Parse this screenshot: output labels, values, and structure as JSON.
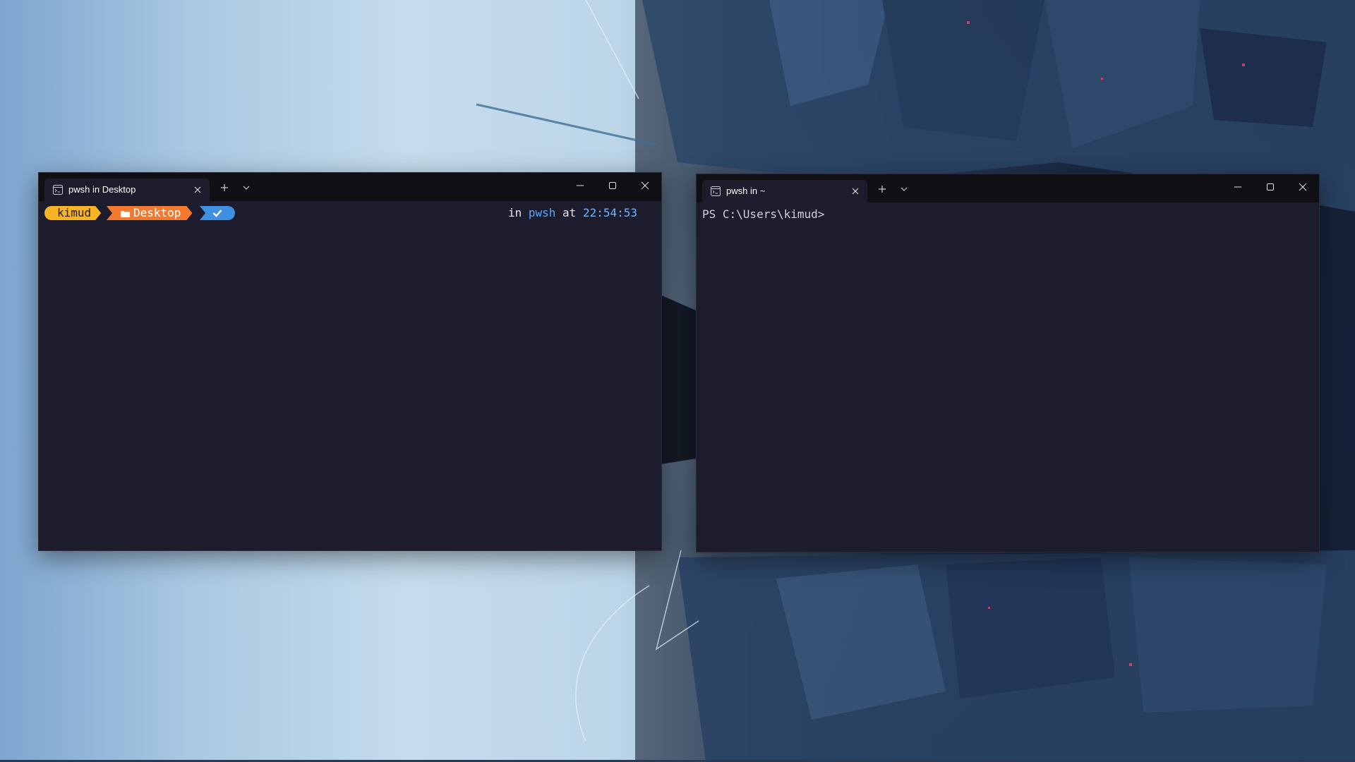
{
  "colors": {
    "terminal_bg": "#1c1c2c",
    "titlebar_bg": "#0f0f14",
    "user_segment": "#f8b324",
    "path_segment": "#f3792e",
    "status_segment": "#3f8fe3",
    "accent_blue": "#5ea8ff"
  },
  "left_window": {
    "tab_title": "pwsh in Desktop",
    "tab_icon": "terminal-icon",
    "prompt": {
      "user": "kimud",
      "path_icon": "folder-icon",
      "path": "Desktop",
      "status_icon": "check-icon",
      "right_in": "in",
      "right_shell": "pwsh",
      "right_at": "at",
      "right_time": "22:54:53"
    }
  },
  "right_window": {
    "tab_title": "pwsh in ~",
    "tab_icon": "terminal-icon",
    "prompt_line": "PS C:\\Users\\kimud>"
  },
  "icons": {
    "new_tab": "plus-icon",
    "tab_menu": "chevron-down-icon",
    "minimize": "minimize-icon",
    "maximize": "maximize-icon",
    "close": "close-icon"
  }
}
